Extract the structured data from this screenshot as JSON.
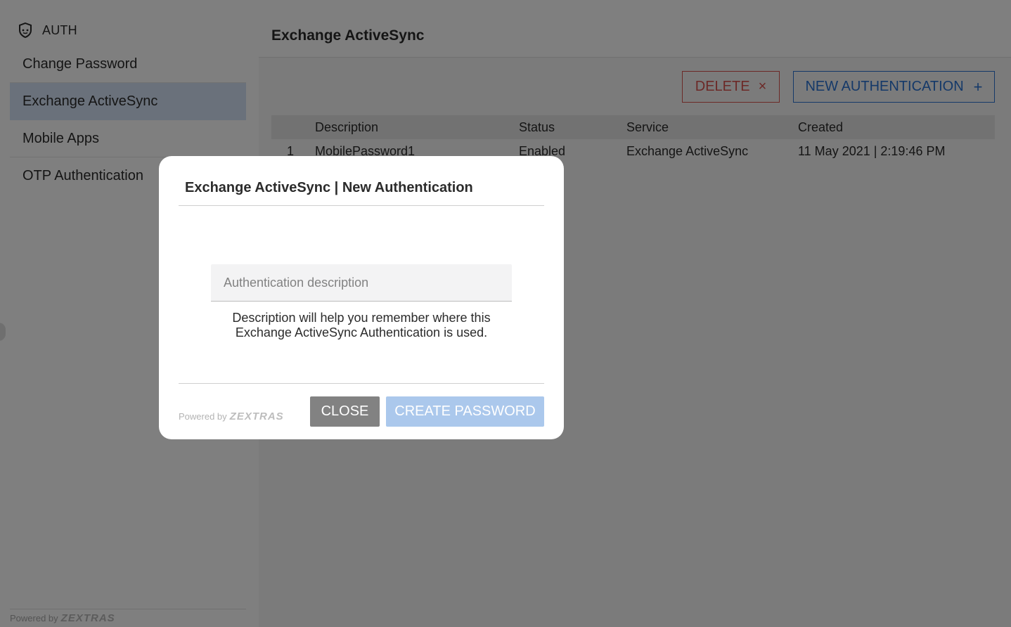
{
  "sidebar": {
    "title": "AUTH",
    "icon": "shield-icon",
    "items": [
      {
        "label": "Change Password",
        "active": false
      },
      {
        "label": "Exchange ActiveSync",
        "active": true
      },
      {
        "label": "Mobile Apps",
        "active": false
      },
      {
        "label": "OTP Authentication",
        "active": false
      }
    ],
    "footer_prefix": "Powered by",
    "footer_brand": "ZEXTRAS"
  },
  "main": {
    "title": "Exchange ActiveSync",
    "delete_label": "DELETE",
    "delete_icon": "×",
    "new_auth_label": "NEW AUTHENTICATION",
    "new_auth_icon": "+",
    "table": {
      "headers": [
        "",
        "Description",
        "Status",
        "Service",
        "Created"
      ],
      "rows": [
        [
          "1",
          "MobilePassword1",
          "Enabled",
          "Exchange ActiveSync",
          "11 May 2021 | 2:19:46 PM"
        ]
      ]
    }
  },
  "modal": {
    "title": "Exchange ActiveSync | New Authentication",
    "input_placeholder": "Authentication description",
    "input_value": "",
    "hint_line1": "Description will help you remember where this",
    "hint_line2": "Exchange ActiveSync Authentication is used.",
    "powered_prefix": "Powered by",
    "powered_brand": "ZEXTRAS",
    "close_label": "CLOSE",
    "create_label": "CREATE PASSWORD"
  },
  "colors": {
    "accent": "#2b73d2",
    "danger": "#d9534f",
    "active_nav": "#d5e3f6",
    "create_disabled": "#abc8ec",
    "close_button": "#828282"
  }
}
